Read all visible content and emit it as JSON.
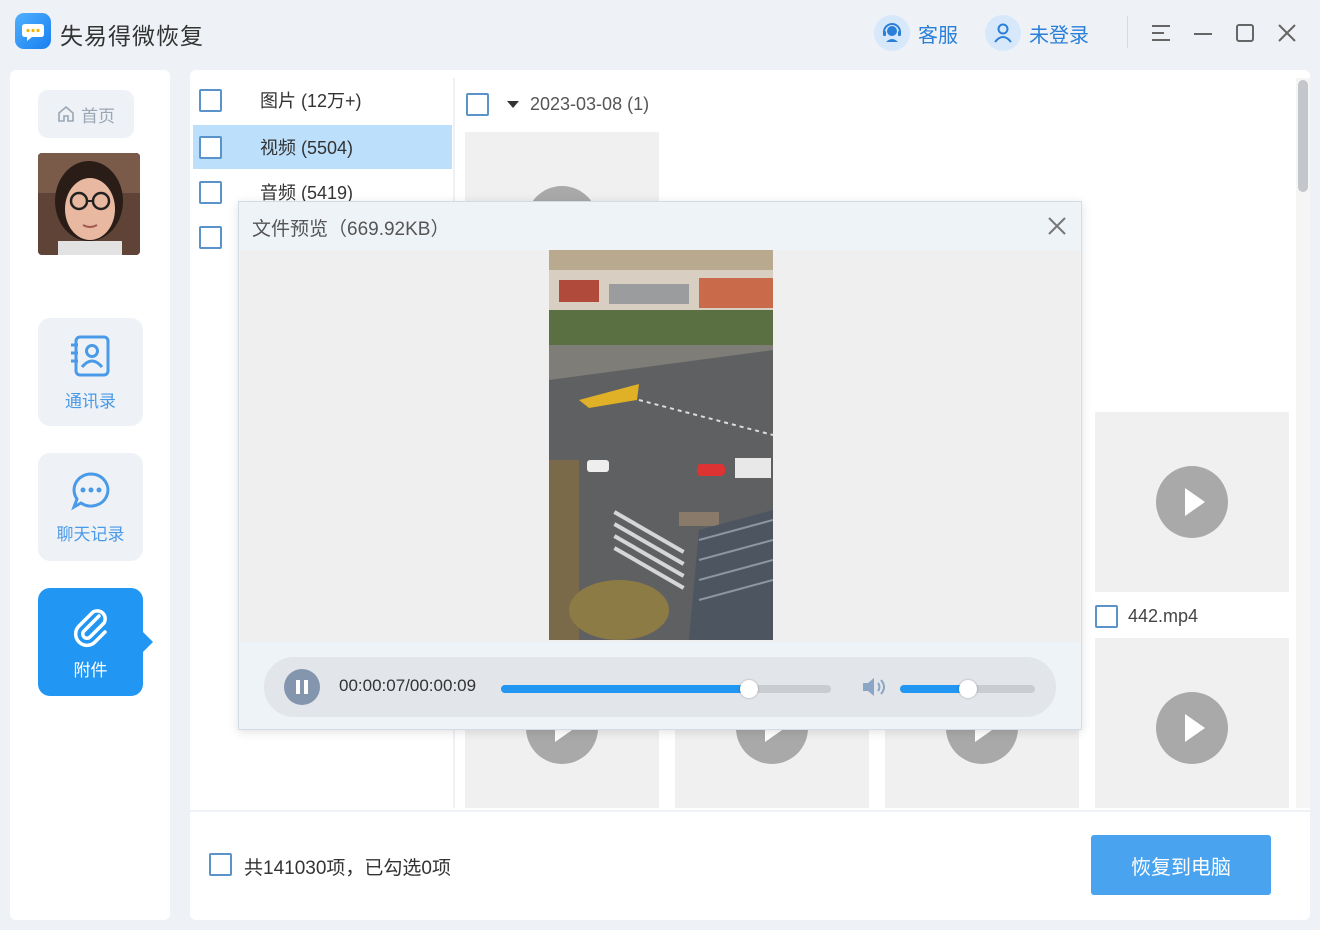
{
  "app": {
    "title": "失易得微恢复",
    "service_label": "客服",
    "login_label": "未登录"
  },
  "sidebar": {
    "home_label": "首页",
    "items": [
      {
        "label": "通讯录",
        "icon": "contacts-icon"
      },
      {
        "label": "聊天记录",
        "icon": "chat-icon"
      },
      {
        "label": "附件",
        "icon": "paperclip-icon",
        "active": true
      }
    ]
  },
  "categories": [
    {
      "label": "图片 (12万+)"
    },
    {
      "label": "视频 (5504)",
      "selected": true
    },
    {
      "label": "音频 (5419)"
    },
    {
      "label": ""
    }
  ],
  "content": {
    "date_group": "2023-03-08 (1)",
    "file_name": "442.mp4"
  },
  "preview": {
    "title": "文件预览（669.92KB）",
    "time": "00:00:07/00:00:09",
    "progress": 0.75,
    "volume": 0.5
  },
  "footer": {
    "summary": "共141030项，已勾选0项",
    "recover_label": "恢复到电脑"
  },
  "colors": {
    "accent": "#2196f3",
    "selected_row": "#bcdffb",
    "recover_button": "#4aa3ee"
  }
}
